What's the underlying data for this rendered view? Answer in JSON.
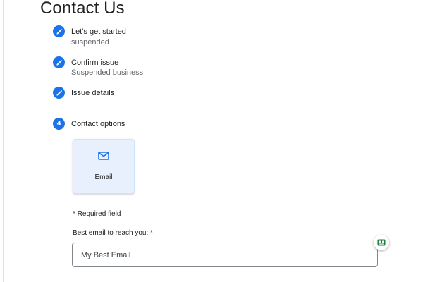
{
  "page": {
    "title": "Contact Us"
  },
  "steps": [
    {
      "title": "Let's get started",
      "subtitle": "suspended",
      "state": "completed"
    },
    {
      "title": "Confirm issue",
      "subtitle": "Suspended business",
      "state": "completed"
    },
    {
      "title": "Issue details",
      "subtitle": "",
      "state": "completed"
    },
    {
      "title": "Contact options",
      "number": "4",
      "state": "current"
    }
  ],
  "contact_options": [
    {
      "label": "Email",
      "icon": "mail-icon",
      "selected": true
    }
  ],
  "form": {
    "required_note": "* Required field",
    "email_label": "Best email to reach you: *",
    "email_placeholder": "My Best Email",
    "email_value": ""
  },
  "colors": {
    "accent": "#1a73e8",
    "card_background": "#e8f0fe",
    "extension_badge": "#188038"
  },
  "icons": {
    "completed_step": "pencil-icon",
    "extension": "extension-badge-icon"
  }
}
